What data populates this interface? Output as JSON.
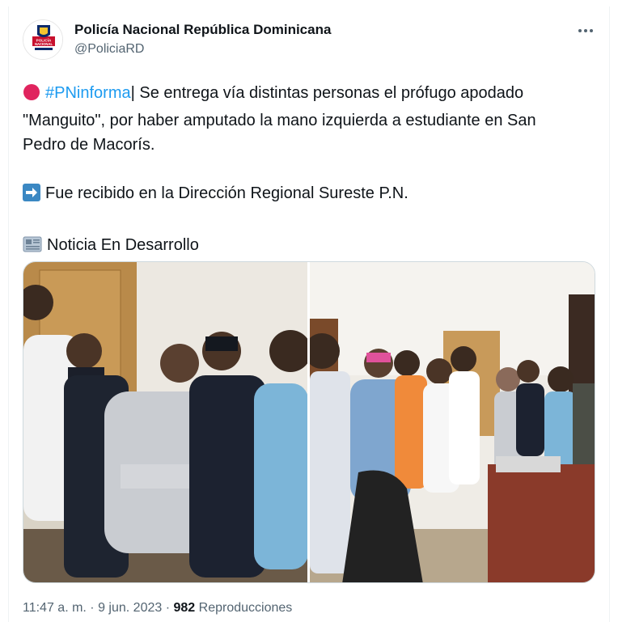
{
  "account": {
    "display_name": "Policía Nacional República Dominicana",
    "handle": "@PoliciaRD",
    "avatar_icon": "policia-nacional-logo-icon",
    "avatar_text": "POLICÍA NACIONAL"
  },
  "more_icon": "more-options-icon",
  "tweet": {
    "hashtag": "#PNinforma",
    "line1_after_hashtag": "| Se entrega vía distintas personas el prófugo apodado",
    "line2": "\"Manguito\", por haber amputado la mano izquierda a estudiante en San",
    "line3": "Pedro de Macorís.",
    "line4": "Fue recibido en la Dirección Regional Sureste P.N.",
    "line5": "Noticia En Desarrollo",
    "emoji1": "red-circle-icon",
    "emoji2": "right-arrow-icon",
    "emoji3": "newspaper-icon"
  },
  "photos": [
    {
      "name": "photo-left",
      "description_icon": "photo-icon"
    },
    {
      "name": "photo-right",
      "description_icon": "photo-icon"
    }
  ],
  "meta": {
    "time": "11:47 a. m.",
    "separator1": " · ",
    "date": "9 jun. 2023",
    "separator2": " · ",
    "views": "982",
    "views_label": " Reproducciones"
  },
  "colors": {
    "accent": "#1d9bf0",
    "text": "#0f1419",
    "secondary": "#536471",
    "red_circle": "#e0245e"
  }
}
